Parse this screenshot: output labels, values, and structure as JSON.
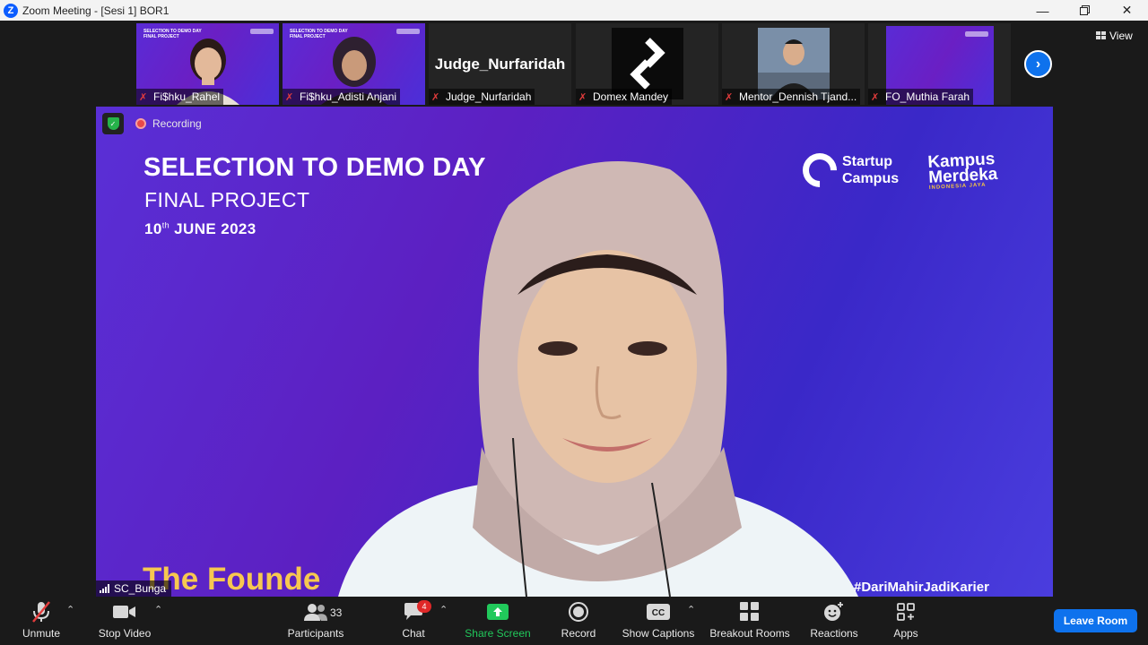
{
  "window": {
    "title": "Zoom Meeting - [Sesi 1] BOR1",
    "logo_letter": "Z"
  },
  "gallery": {
    "tiles": [
      {
        "name": "Fi$hku_Rahel",
        "muted": true
      },
      {
        "name": "Fi$hku_Adisti Anjani",
        "muted": true
      },
      {
        "name": "Judge_Nurfaridah",
        "muted": true,
        "display_name": "Judge_Nurfaridah"
      },
      {
        "name": "Domex Mandey",
        "muted": true
      },
      {
        "name": "Mentor_Dennish Tjand...",
        "muted": true
      },
      {
        "name": "FO_Muthia Farah",
        "muted": true
      }
    ],
    "view_label": "View"
  },
  "main": {
    "recording_label": "Recording",
    "slide": {
      "title": "SELECTION TO DEMO DAY",
      "subtitle": "FINAL PROJECT",
      "date_day": "10",
      "date_suffix": "th",
      "date_rest": "JUNE 2023",
      "brand1_line1": "Startup",
      "brand1_line2": "Campus",
      "brand2_line1": "Kampus",
      "brand2_line2": "Merdeka",
      "brand2_sub": "INDONESIA JAYA",
      "founder_text": "The Founde",
      "hashtag": "#DariMahirJadiKarier"
    },
    "speaker_name": "SC_Bunga"
  },
  "toolbar": {
    "unmute": "Unmute",
    "stop_video": "Stop Video",
    "participants": "Participants",
    "participants_count": "33",
    "chat": "Chat",
    "chat_badge": "4",
    "share_screen": "Share Screen",
    "record": "Record",
    "show_captions": "Show Captions",
    "captions_icon_text": "CC",
    "breakout_rooms": "Breakout Rooms",
    "reactions": "Reactions",
    "apps": "Apps",
    "leave_room": "Leave Room"
  },
  "colors": {
    "accent": "#0e72ed",
    "share_green": "#21c95b",
    "muted_red": "#e23c3c",
    "slide_purple": "#5a2fd6",
    "founder_yellow": "#f7c850"
  }
}
